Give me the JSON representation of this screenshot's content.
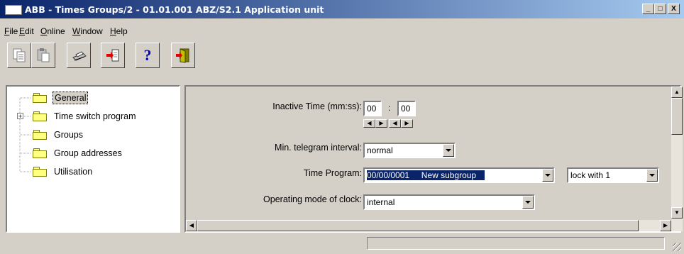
{
  "window": {
    "title": "ABB - Times Groups/2 - 01.01.001 ABZ/S2.1 Application unit",
    "controls": [
      "_",
      "□",
      "X"
    ]
  },
  "menu": [
    {
      "label": "File",
      "accel": "F"
    },
    {
      "label": "Edit",
      "accel": "E"
    },
    {
      "label": "Online",
      "accel": "O"
    },
    {
      "label": "Window",
      "accel": "W"
    },
    {
      "label": "Help",
      "accel": "H"
    }
  ],
  "toolbar": {
    "buttons": [
      "copy-icon",
      "paste-icon",
      "print-icon",
      "import-icon",
      "help-icon",
      "exit-icon"
    ]
  },
  "tree": {
    "items": [
      {
        "label": "General",
        "selected": true
      },
      {
        "label": "Time switch program",
        "expandable": true
      },
      {
        "label": "Groups"
      },
      {
        "label": "Group addresses"
      },
      {
        "label": "Utilisation"
      }
    ]
  },
  "form": {
    "inactive_time": {
      "label": "Inactive Time (mm:ss):",
      "minutes": "00",
      "separator": ":",
      "seconds": "00"
    },
    "min_telegram": {
      "label": "Min. telegram interval:",
      "value": "normal"
    },
    "time_program": {
      "label": "Time Program:",
      "value": "00/00/0001     New subgroup",
      "lock_value": "lock with 1"
    },
    "operating_mode": {
      "label": "Operating mode of clock:",
      "value": "internal"
    }
  },
  "colors": {
    "selection": "#0a246a",
    "titlebar": "#0a246a"
  }
}
